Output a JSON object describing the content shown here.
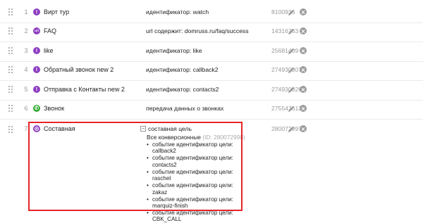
{
  "goals": [
    {
      "num": "1",
      "name": "Вирт тур",
      "condition": "идентификатор: watch",
      "id": "8100936",
      "icon": "exclamation-icon",
      "icon_symbol": "!",
      "icon_color": "#8e3fc1"
    },
    {
      "num": "2",
      "name": "FAQ",
      "condition": "url содержит: domruss.ru/faq/success",
      "id": "14316763",
      "icon": "url-icon",
      "icon_symbol": "url",
      "icon_color": "#8e3fc1"
    },
    {
      "num": "3",
      "name": "like",
      "condition": "идентификатор: like",
      "id": "25681409",
      "icon": "exclamation-icon",
      "icon_symbol": "!",
      "icon_color": "#8e3fc1"
    },
    {
      "num": "4",
      "name": "Обратный звонок new 2",
      "condition": "идентификатор: callback2",
      "id": "274930307",
      "icon": "exclamation-icon",
      "icon_symbol": "!",
      "icon_color": "#8e3fc1"
    },
    {
      "num": "5",
      "name": "Отправка с Контакты new 2",
      "condition": "идентификатор: contacts2",
      "id": "274930326",
      "icon": "exclamation-icon",
      "icon_symbol": "!",
      "icon_color": "#8e3fc1"
    },
    {
      "num": "6",
      "name": "Звонок",
      "condition": "передача данных о звонках",
      "id": "275547613",
      "icon": "phone-icon",
      "icon_symbol": "✆",
      "icon_color": "#2fa82f"
    }
  ],
  "composite": {
    "num": "7",
    "name": "Составная",
    "header": "составная цель",
    "toggle_symbol": "−",
    "id": "280072997",
    "icon": "composite-icon",
    "icon_symbol": "◎",
    "icon_color": "#8e3fc1",
    "all_conversions_label": "Все конверсионные",
    "all_conversions_id": "(ID: 280072998)",
    "subgoals": [
      "событие идентификатор цели: callback2",
      "событие идентификатор цели: contacts2",
      "событие идентификатор цели: raschet",
      "событие идентификатор цели: zakaz",
      "событие идентификатор цели: marquiz-finish",
      "событие идентификатор цели: CBK_CALL"
    ]
  },
  "accent_colors": {
    "highlight": "#e5252a",
    "goal_icon": "#8e3fc1",
    "phone_icon": "#2fa82f"
  }
}
